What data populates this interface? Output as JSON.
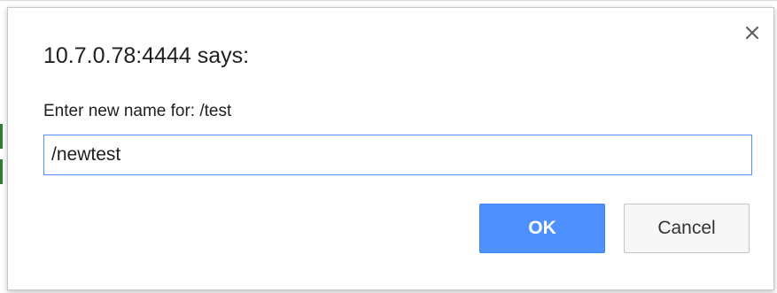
{
  "dialog": {
    "title": "10.7.0.78:4444 says:",
    "message": "Enter new name for: /test",
    "input_value": "/newtest",
    "ok_label": "OK",
    "cancel_label": "Cancel",
    "close_icon": "close-icon"
  },
  "colors": {
    "ok_button": "#4d90fe",
    "input_focus_border": "#4d90fe",
    "cancel_button": "#f7f7f7"
  }
}
